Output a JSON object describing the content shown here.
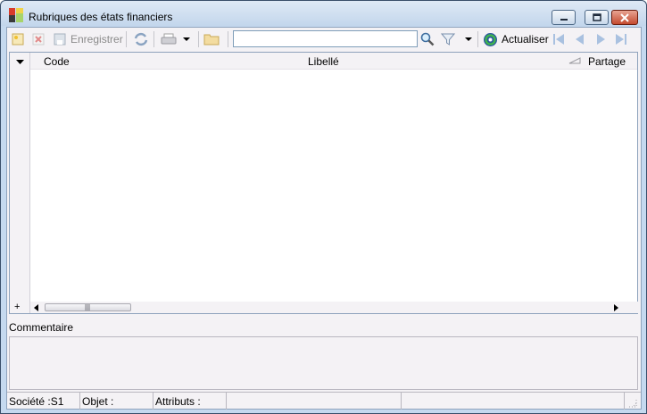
{
  "window": {
    "title": "Rubriques des états financiers"
  },
  "toolbar": {
    "save_label": "Enregistrer",
    "search_value": "",
    "refresh_label": "Actualiser",
    "icons": [
      "new-icon",
      "delete-icon",
      "save-icon",
      "sync-icon",
      "print-icon",
      "folder-icon",
      "search-icon",
      "filter-icon",
      "refresh-icon",
      "first-icon",
      "prev-icon",
      "next-icon",
      "last-icon"
    ]
  },
  "grid": {
    "columns": [
      "Code",
      "Libellé",
      "Partage"
    ],
    "rows": []
  },
  "comment": {
    "label": "Commentaire",
    "value": ""
  },
  "status": {
    "societe": "Société :S1",
    "objet": "Objet :",
    "attributs": "Attributs :"
  },
  "colors": {
    "titlebar": "#c5d9ef",
    "client": "#f4f2f5",
    "close_button": "#c44a2f",
    "refresh_accent": "#2c8a3c"
  }
}
